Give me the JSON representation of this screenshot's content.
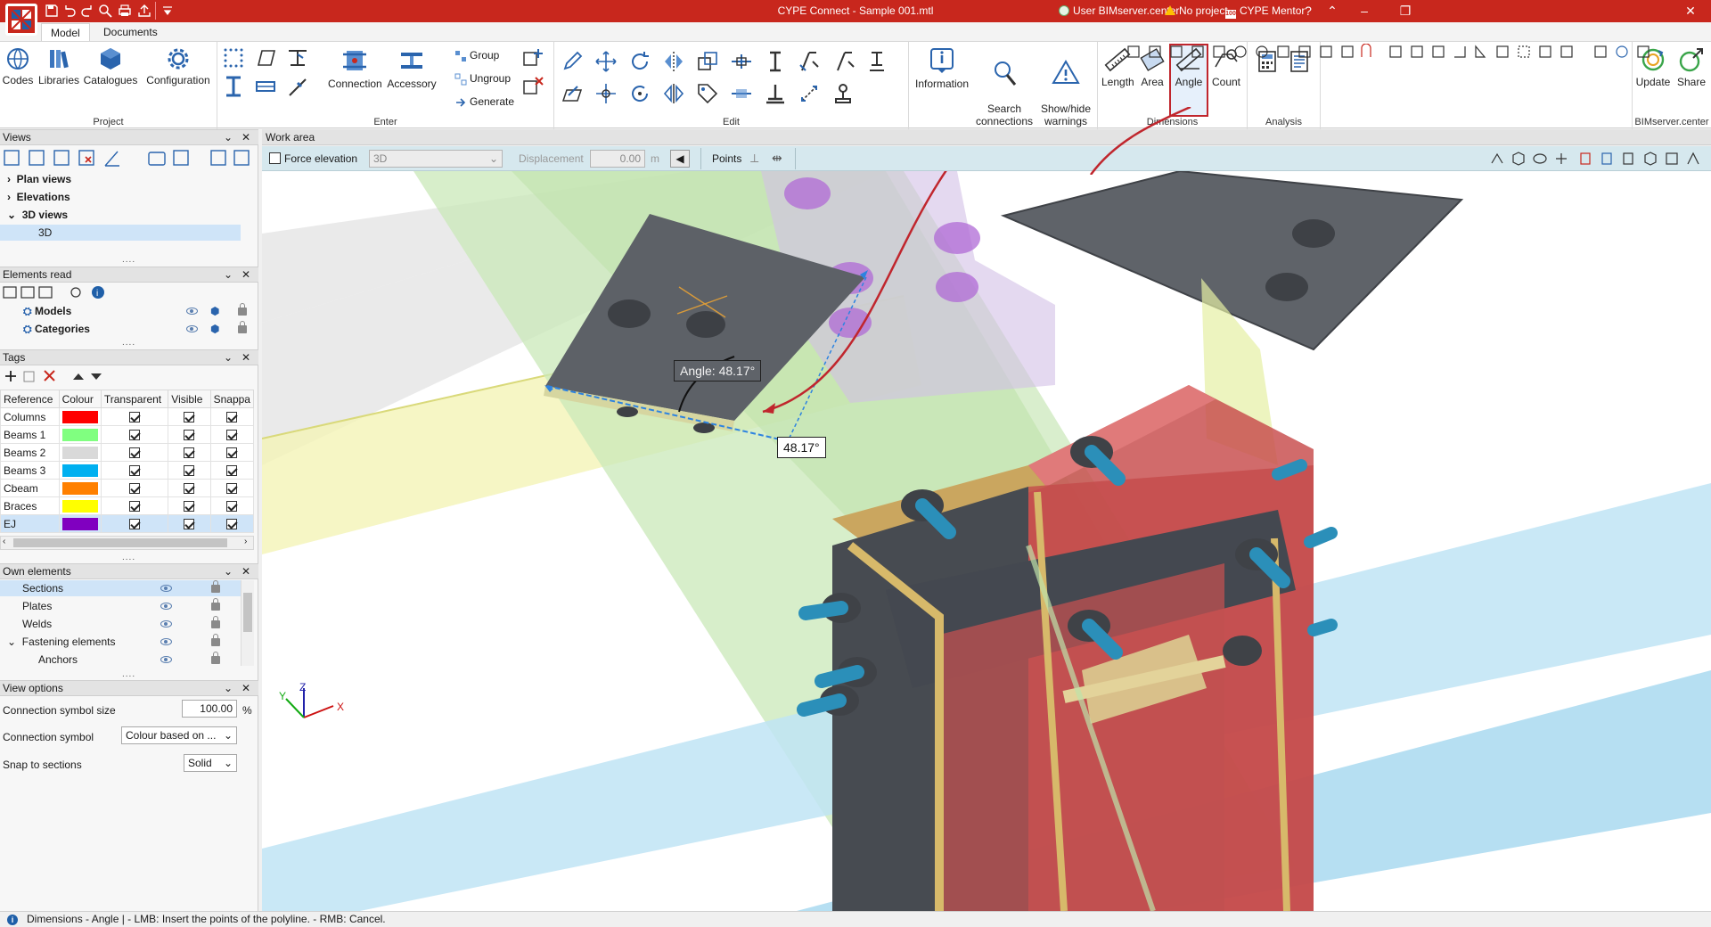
{
  "window": {
    "title": "CYPE Connect - Sample 001.mtl",
    "user": "User BIMserver.center",
    "project": "No project",
    "mentor": "CYPE Mentor"
  },
  "tabs": [
    "Model",
    "Documents"
  ],
  "ribbon": {
    "project": {
      "label": "Project",
      "buttons": [
        "Codes",
        "Libraries",
        "Catalogues",
        "Configuration"
      ]
    },
    "enter": {
      "label": "Enter",
      "buttons": [
        "Connection",
        "Accessory"
      ],
      "small": [
        "Group",
        "Ungroup",
        "Generate"
      ]
    },
    "edit": {
      "label": "Edit"
    },
    "info": {
      "buttons": [
        "Information",
        "Search\nconnections",
        "Show/hide\nwarnings"
      ]
    },
    "dimensions": {
      "label": "Dimensions",
      "buttons": [
        "Length",
        "Area",
        "Angle",
        "Count"
      ]
    },
    "analysis": {
      "label": "Analysis"
    },
    "bimserver": {
      "label": "BIMserver.center",
      "buttons": [
        "Update",
        "Share"
      ]
    }
  },
  "panels": {
    "views": {
      "title": "Views",
      "items": [
        {
          "label": "Plan views",
          "expanded": false
        },
        {
          "label": "Elevations",
          "expanded": false
        },
        {
          "label": "3D views",
          "expanded": true
        },
        {
          "label": "3D",
          "child": true,
          "selected": true
        }
      ]
    },
    "elements_read": {
      "title": "Elements read",
      "items": [
        {
          "label": "Models"
        },
        {
          "label": "Categories"
        }
      ]
    },
    "tags": {
      "title": "Tags",
      "columns": [
        "Reference",
        "Colour",
        "Transparent",
        "Visible",
        "Snappa"
      ],
      "rows": [
        {
          "ref": "Columns",
          "color": "#ff0000"
        },
        {
          "ref": "Beams 1",
          "color": "#80ff80"
        },
        {
          "ref": "Beams 2",
          "color": "#d9d9d9"
        },
        {
          "ref": "Beams 3",
          "color": "#00b0f0"
        },
        {
          "ref": "Cbeam",
          "color": "#ff8000"
        },
        {
          "ref": "Braces",
          "color": "#ffff00"
        },
        {
          "ref": "EJ",
          "color": "#8000c0",
          "selected": true
        }
      ]
    },
    "own_elements": {
      "title": "Own elements",
      "items": [
        {
          "label": "Sections",
          "selected": true
        },
        {
          "label": "Plates"
        },
        {
          "label": "Welds"
        },
        {
          "label": "Fastening elements",
          "expanded": true
        },
        {
          "label": "Anchors",
          "child": true
        }
      ]
    },
    "view_options": {
      "title": "View options",
      "symbol_size_label": "Connection symbol size",
      "symbol_size_value": "100.00",
      "symbol_size_unit": "%",
      "symbol_label": "Connection symbol",
      "symbol_value": "Colour based on ...",
      "snap_label": "Snap to sections",
      "snap_value": "Solid"
    }
  },
  "work_area": {
    "title": "Work area",
    "force_elevation": "Force elevation",
    "view_select": "3D",
    "displacement_label": "Displacement",
    "displacement_value": "0.00",
    "displacement_unit": "m",
    "points_label": "Points"
  },
  "viewport": {
    "angle_tooltip": "Angle: 48.17°",
    "angle_label": "48.17°",
    "axes": {
      "x": "X",
      "y": "Y",
      "z": "Z"
    }
  },
  "status": "Dimensions - Angle  |  - LMB: Insert the points of the polyline. - RMB: Cancel.",
  "colors": {
    "title_bar": "#c8271d",
    "accent_highlight": "#c0262d",
    "selection": "#cfe4f8"
  }
}
